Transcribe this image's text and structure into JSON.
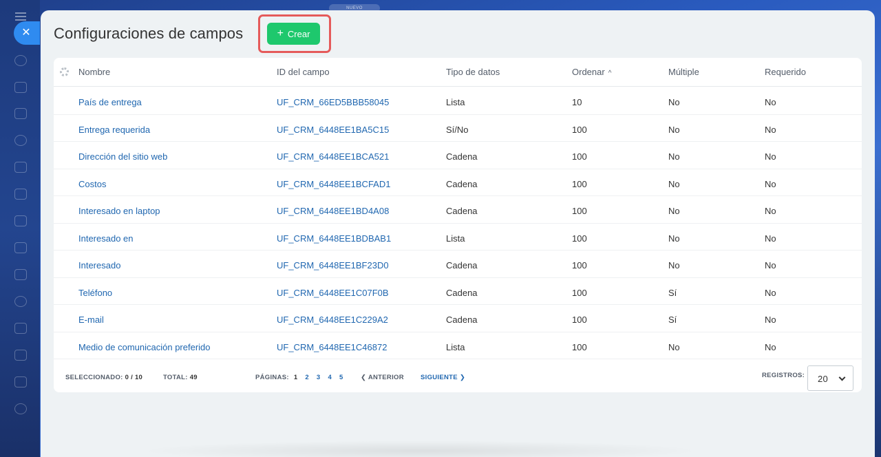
{
  "badge": "NUEVO",
  "page_title": "Configuraciones de campos",
  "create_label": "Crear",
  "columns": [
    "Nombre",
    "ID del campo",
    "Tipo de datos",
    "Ordenar",
    "Múltiple",
    "Requerido"
  ],
  "rows": [
    [
      "País de entrega",
      "UF_CRM_66ED5BBB58045",
      "Lista",
      "10",
      "No",
      "No"
    ],
    [
      "Entrega requerida",
      "UF_CRM_6448EE1BA5C15",
      "Sí/No",
      "100",
      "No",
      "No"
    ],
    [
      "Dirección del sitio web",
      "UF_CRM_6448EE1BCA521",
      "Cadena",
      "100",
      "No",
      "No"
    ],
    [
      "Costos",
      "UF_CRM_6448EE1BCFAD1",
      "Cadena",
      "100",
      "No",
      "No"
    ],
    [
      "Interesado en laptop",
      "UF_CRM_6448EE1BD4A08",
      "Cadena",
      "100",
      "No",
      "No"
    ],
    [
      "Interesado en",
      "UF_CRM_6448EE1BDBAB1",
      "Lista",
      "100",
      "No",
      "No"
    ],
    [
      "Interesado",
      "UF_CRM_6448EE1BF23D0",
      "Cadena",
      "100",
      "No",
      "No"
    ],
    [
      "Teléfono",
      "UF_CRM_6448EE1C07F0B",
      "Cadena",
      "100",
      "Sí",
      "No"
    ],
    [
      "E-mail",
      "UF_CRM_6448EE1C229A2",
      "Cadena",
      "100",
      "Sí",
      "No"
    ],
    [
      "Medio de comunicación preferido",
      "UF_CRM_6448EE1C46872",
      "Lista",
      "100",
      "No",
      "No"
    ]
  ],
  "footer": {
    "selected_label": "SELECCIONADO:",
    "selected_value": "0 / 10",
    "total_label": "TOTAL:",
    "total_value": "49",
    "pages_label": "PÁGINAS:",
    "pages": [
      "1",
      "2",
      "3",
      "4",
      "5"
    ],
    "prev_label": "ANTERIOR",
    "next_label": "SIGUIENTE",
    "records_label": "REGISTROS:",
    "records_value": "20"
  },
  "colors": {
    "accent_green": "#1ec86d",
    "link_blue": "#2067b0",
    "highlight_red": "#e55a5a",
    "close_blue": "#2f8bf0"
  }
}
